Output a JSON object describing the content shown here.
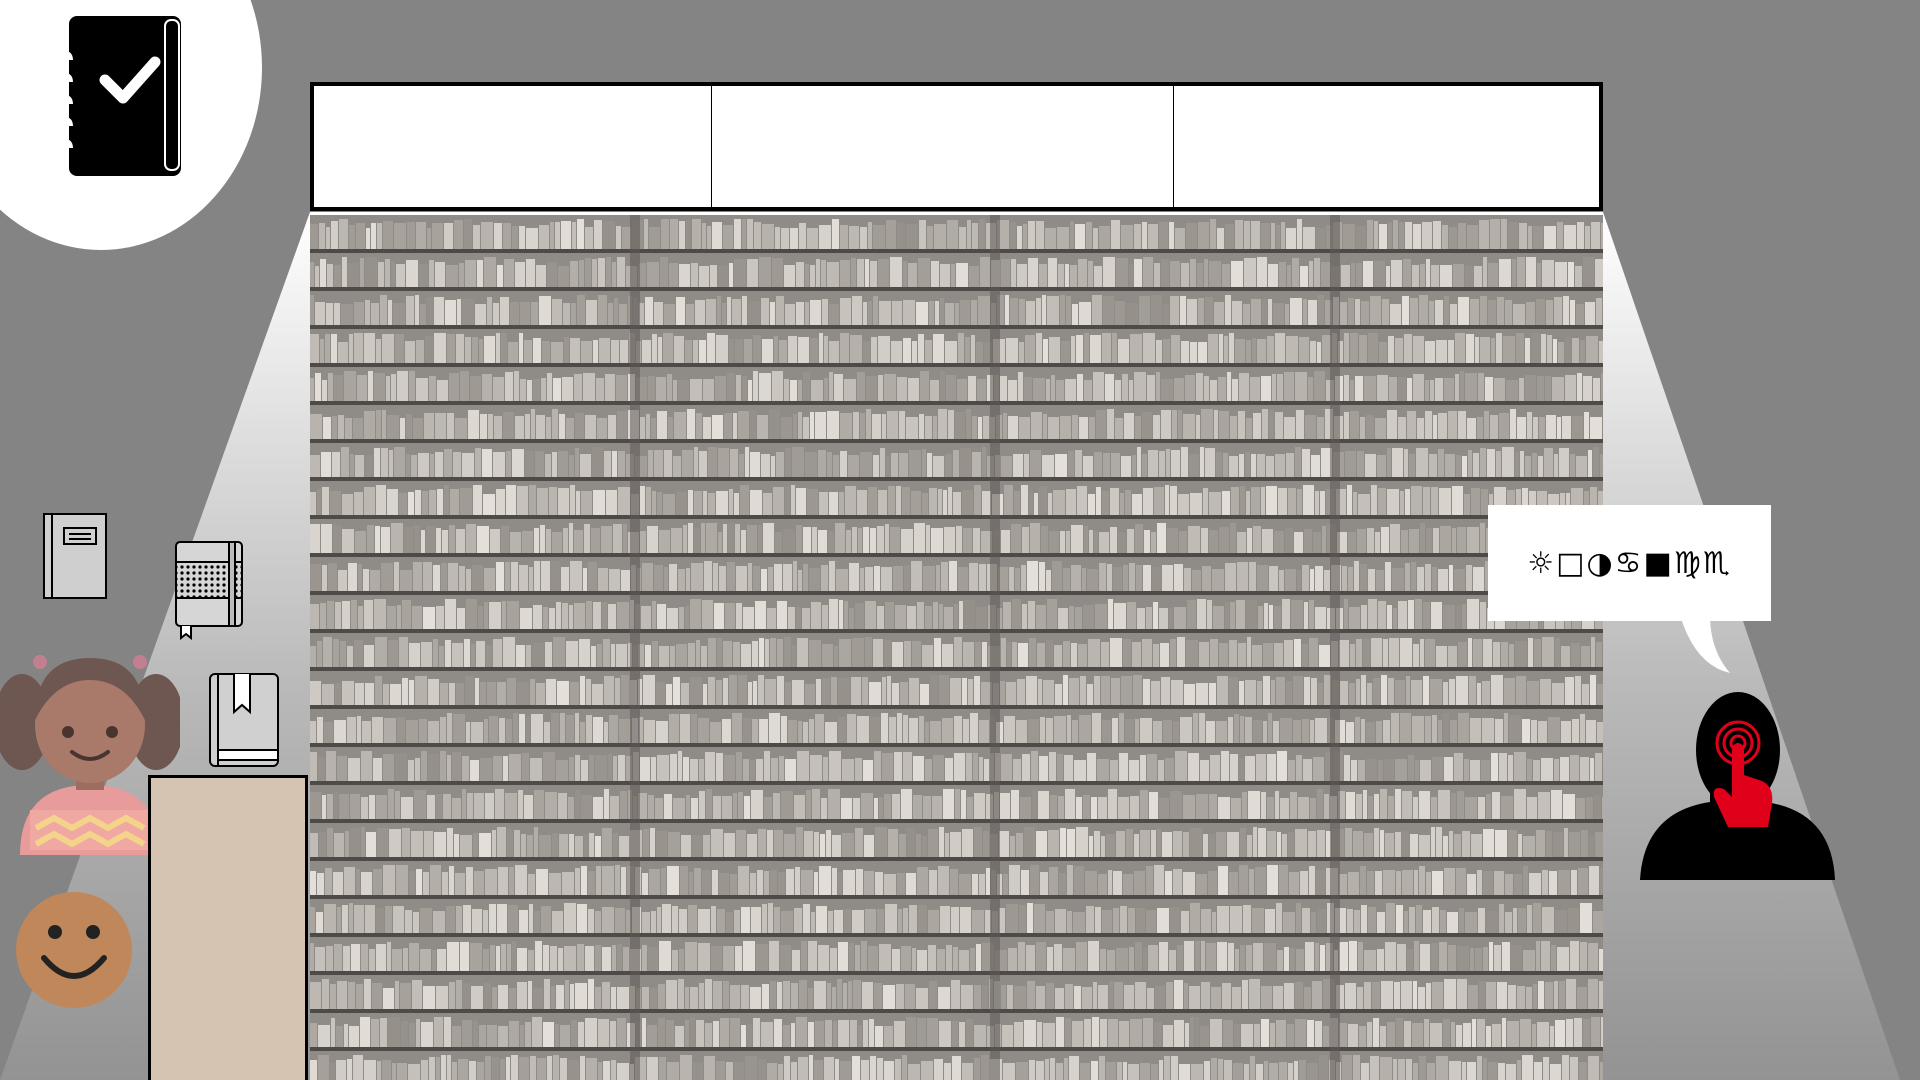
{
  "title_row": {
    "cells": [
      "",
      "",
      ""
    ]
  },
  "speech_bubble": {
    "text": "☼□◑♋■♍♏"
  },
  "icons": {
    "logo": "checked-notebook-icon",
    "book_1": "book-icon",
    "book_2": "dotted-notebook-icon",
    "book_3": "bookmarked-book-icon",
    "character": "girl-avatar",
    "smiley": "smiley-face-icon",
    "listener": "person-touching-ear-icon"
  },
  "colors": {
    "background": "#848484",
    "panel": "#d5c4b2",
    "accent_red": "#e0001a",
    "skin": "#b88a66"
  }
}
